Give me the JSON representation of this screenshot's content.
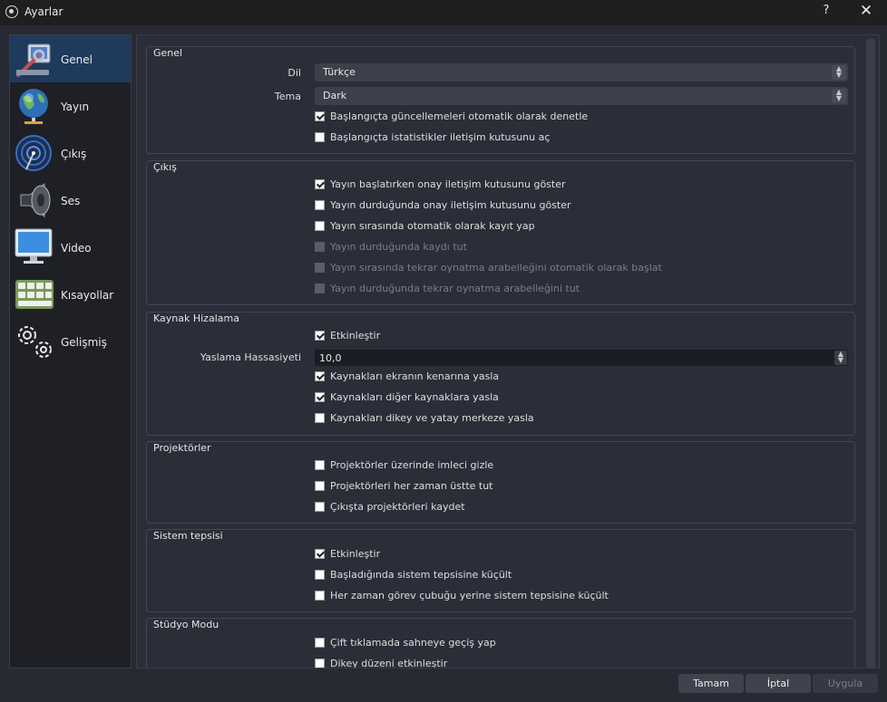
{
  "window": {
    "title": "Ayarlar",
    "help_label": "?",
    "close_label": "✕"
  },
  "sidebar": {
    "items": [
      {
        "label": "Genel",
        "icon": "wrench-icon"
      },
      {
        "label": "Yayın",
        "icon": "globe-icon"
      },
      {
        "label": "Çıkış",
        "icon": "broadcast-icon"
      },
      {
        "label": "Ses",
        "icon": "speaker-icon"
      },
      {
        "label": "Video",
        "icon": "monitor-icon"
      },
      {
        "label": "Kısayollar",
        "icon": "keyboard-icon"
      },
      {
        "label": "Gelişmiş",
        "icon": "gears-icon"
      }
    ],
    "active": "Genel"
  },
  "sections": {
    "genel": {
      "title": "Genel",
      "dil_label": "Dil",
      "dil_value": "Türkçe",
      "tema_label": "Tema",
      "tema_value": "Dark",
      "cb_updates": {
        "label": "Başlangıçta güncellemeleri otomatik olarak denetle",
        "checked": true
      },
      "cb_stats": {
        "label": "Başlangıçta istatistikler iletişim kutusunu aç",
        "checked": false
      }
    },
    "cikis": {
      "title": "Çıkış",
      "cb1": {
        "label": "Yayın başlatırken onay iletişim kutusunu göster",
        "checked": true
      },
      "cb2": {
        "label": "Yayın durduğunda onay iletişim kutusunu göster",
        "checked": false
      },
      "cb3": {
        "label": "Yayın sırasında otomatik olarak kayıt yap",
        "checked": false
      },
      "cb4": {
        "label": "Yayın durduğunda kaydı tut",
        "checked": false,
        "disabled": true
      },
      "cb5": {
        "label": "Yayın sırasında tekrar oynatma arabelleğini otomatik olarak başlat",
        "checked": false,
        "disabled": true
      },
      "cb6": {
        "label": "Yayın durduğunda tekrar oynatma arabelleğini tut",
        "checked": false,
        "disabled": true
      }
    },
    "hizalama": {
      "title": "Kaynak Hizalama",
      "cb_enable": {
        "label": "Etkinleştir",
        "checked": true
      },
      "sens_label": "Yaslama Hassasiyeti",
      "sens_value": "10,0",
      "cb_edge": {
        "label": "Kaynakları ekranın kenarına yasla",
        "checked": true
      },
      "cb_other": {
        "label": "Kaynakları diğer kaynaklara yasla",
        "checked": true
      },
      "cb_center": {
        "label": "Kaynakları dikey ve yatay merkeze yasla",
        "checked": false
      }
    },
    "projektorler": {
      "title": "Projektörler",
      "cb1": {
        "label": "Projektörler üzerinde imleci gizle",
        "checked": false
      },
      "cb2": {
        "label": "Projektörleri her zaman üstte tut",
        "checked": false
      },
      "cb3": {
        "label": "Çıkışta projektörleri kaydet",
        "checked": false
      }
    },
    "tepsi": {
      "title": "Sistem tepsisi",
      "cb1": {
        "label": "Etkinleştir",
        "checked": true
      },
      "cb2": {
        "label": "Başladığında sistem tepsisine küçült",
        "checked": false
      },
      "cb3": {
        "label": "Her zaman görev çubuğu yerine sistem tepsisine küçült",
        "checked": false
      }
    },
    "studyo": {
      "title": "Stüdyo Modu",
      "cb1": {
        "label": "Çift tıklamada sahneye geçiş yap",
        "checked": false
      },
      "cb2": {
        "label": "Dikey düzeni etkinleştir",
        "checked": false
      }
    }
  },
  "buttons": {
    "ok": "Tamam",
    "cancel": "İptal",
    "apply": "Uygula"
  }
}
